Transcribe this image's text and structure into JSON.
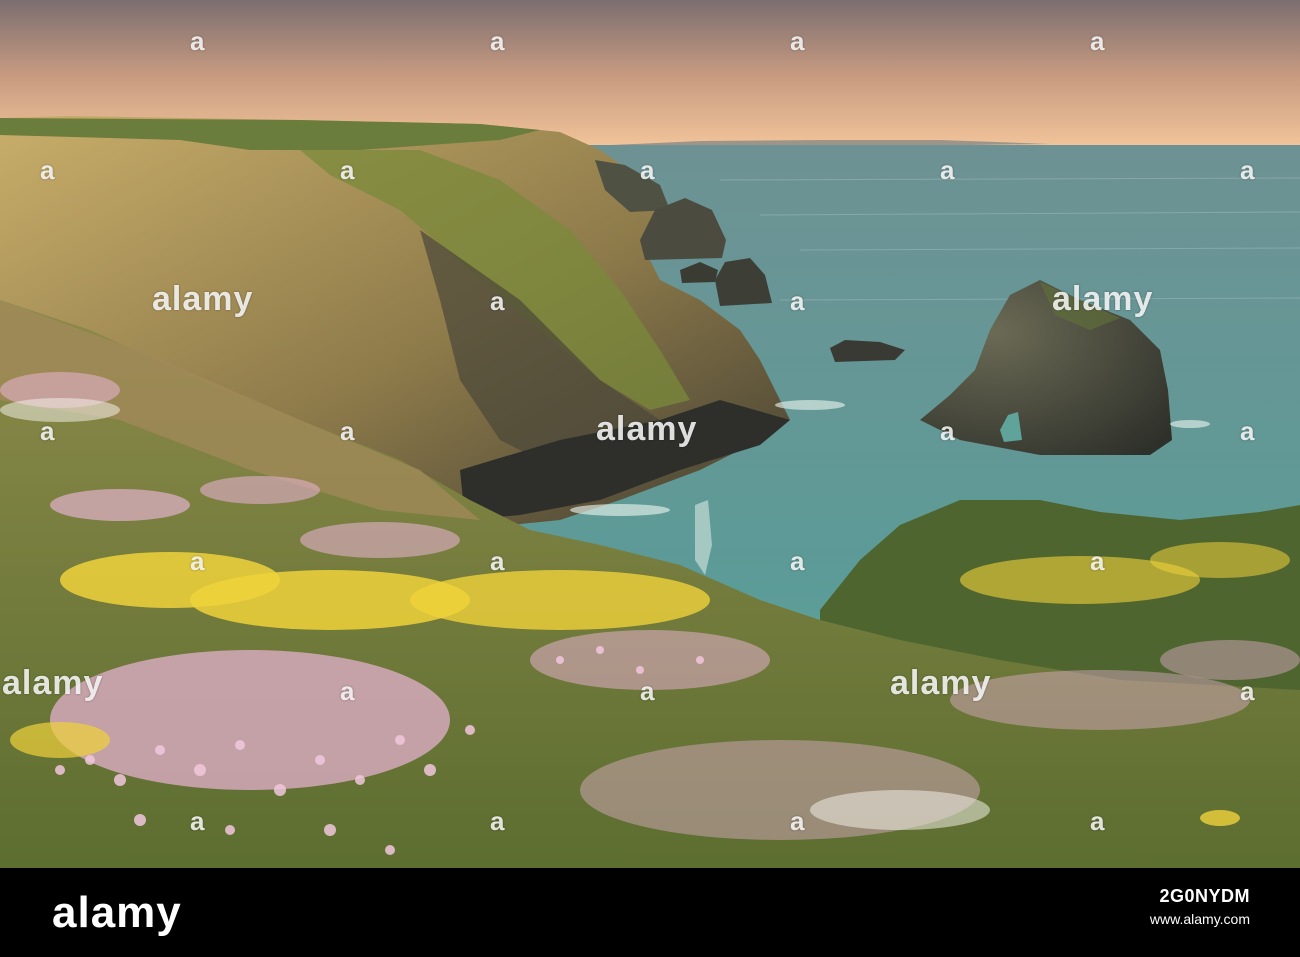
{
  "watermark": {
    "logo": "alamy",
    "glyph": "a"
  },
  "footer": {
    "logo": "alamy",
    "image_id": "2G0NYDM",
    "url": "www.alamy.com"
  },
  "colors": {
    "sky_top": "#7d6f72",
    "sky_horizon": "#f2c49a",
    "sea_far": "#5f8e90",
    "sea_near": "#5aa59a",
    "cliff_sun": "#b89a55",
    "cliff_shadow": "#4e4a3c",
    "grass": "#6f8a3a",
    "thrift_pink": "#e6b3d0",
    "vetch_yellow": "#f2d33a",
    "footer_bg": "#000000"
  }
}
